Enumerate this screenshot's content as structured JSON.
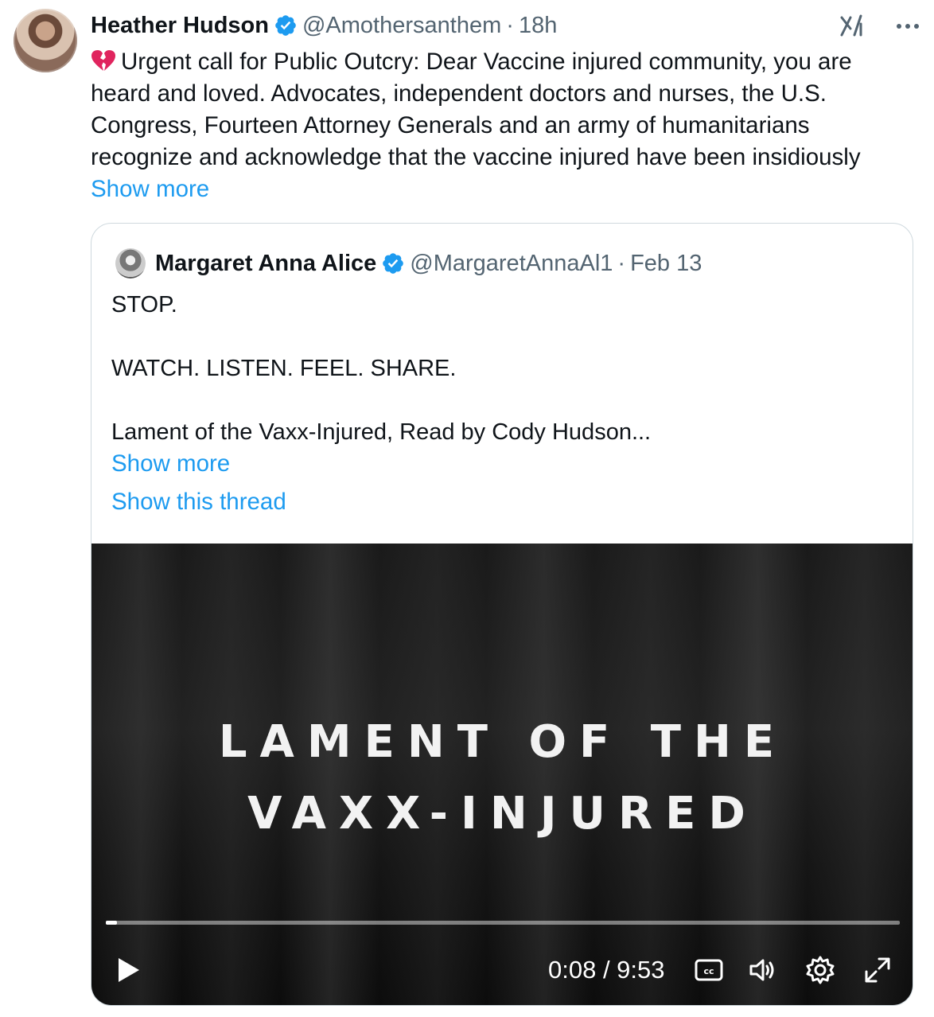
{
  "tweet": {
    "author": {
      "name": "Heather Hudson",
      "handle": "@Amothersanthem",
      "separator": "·",
      "time": "18h"
    },
    "text_lines": [
      "Urgent call for Public Outcry: Dear Vaccine injured community, you are",
      "heard and loved. Advocates, independent doctors and nurses, the U.S.",
      "Congress, Fourteen Attorney Generals and an army of humanitarians",
      "recognize and acknowledge that the vaccine injured have been insidiously"
    ],
    "show_more": "Show more"
  },
  "quote": {
    "author": {
      "name": "Margaret Anna Alice",
      "handle": "@MargaretAnnaAl1",
      "separator": "·",
      "date": "Feb 13"
    },
    "text_lines": [
      "STOP.",
      "",
      "WATCH. LISTEN. FEEL. SHARE.",
      "",
      "Lament of the Vaxx-Injured, Read by Cody Hudson..."
    ],
    "show_more": "Show more",
    "show_thread": "Show this thread"
  },
  "video": {
    "title_line1": "LAMENT OF THE",
    "title_line2": "VAXX-INJURED",
    "time": "0:08 / 9:53",
    "progress": 0.014
  },
  "colors": {
    "link": "#1d9bf0",
    "verified": "#1d9bf0",
    "heart": "#e0245e",
    "secondary_text": "#536471"
  },
  "icons": [
    "grok-icon",
    "more-icon",
    "verified-badge-icon",
    "broken-heart-icon",
    "play-icon",
    "captions-icon",
    "volume-icon",
    "settings-gear-icon",
    "fullscreen-icon"
  ]
}
